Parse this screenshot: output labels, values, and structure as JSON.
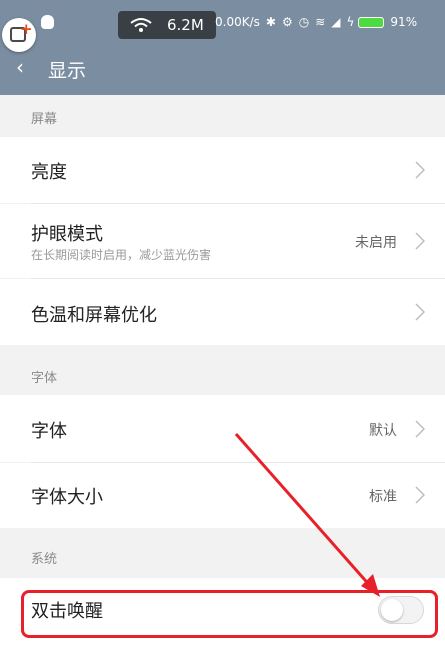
{
  "status_bar": {
    "net_speed": "6.2M",
    "rate": "0.00K/s",
    "battery": "91%",
    "icons": [
      "qq-icon",
      "wifi-icon",
      "bluetooth-icon",
      "settings-icon",
      "alarm-icon",
      "signal-icon",
      "charging-icon",
      "battery-icon"
    ]
  },
  "header": {
    "back_icon": "back-chevron-icon",
    "title": "显示"
  },
  "sections": {
    "screen": "屏幕",
    "font": "字体",
    "system": "系统"
  },
  "rows": {
    "brightness": {
      "label": "亮度"
    },
    "eye_mode": {
      "label": "护眼模式",
      "subtitle": "在长期阅读时启用，减少蓝光伤害",
      "value": "未启用"
    },
    "color_temp": {
      "label": "色温和屏幕优化"
    },
    "font": {
      "label": "字体",
      "value": "默认"
    },
    "font_size": {
      "label": "字体大小",
      "value": "标准"
    },
    "double_tap": {
      "label": "双击唤醒",
      "enabled": false
    }
  },
  "colors": {
    "header": "#7b8ea1",
    "annotation": "#e8202a",
    "battery": "#4ddb3f"
  }
}
